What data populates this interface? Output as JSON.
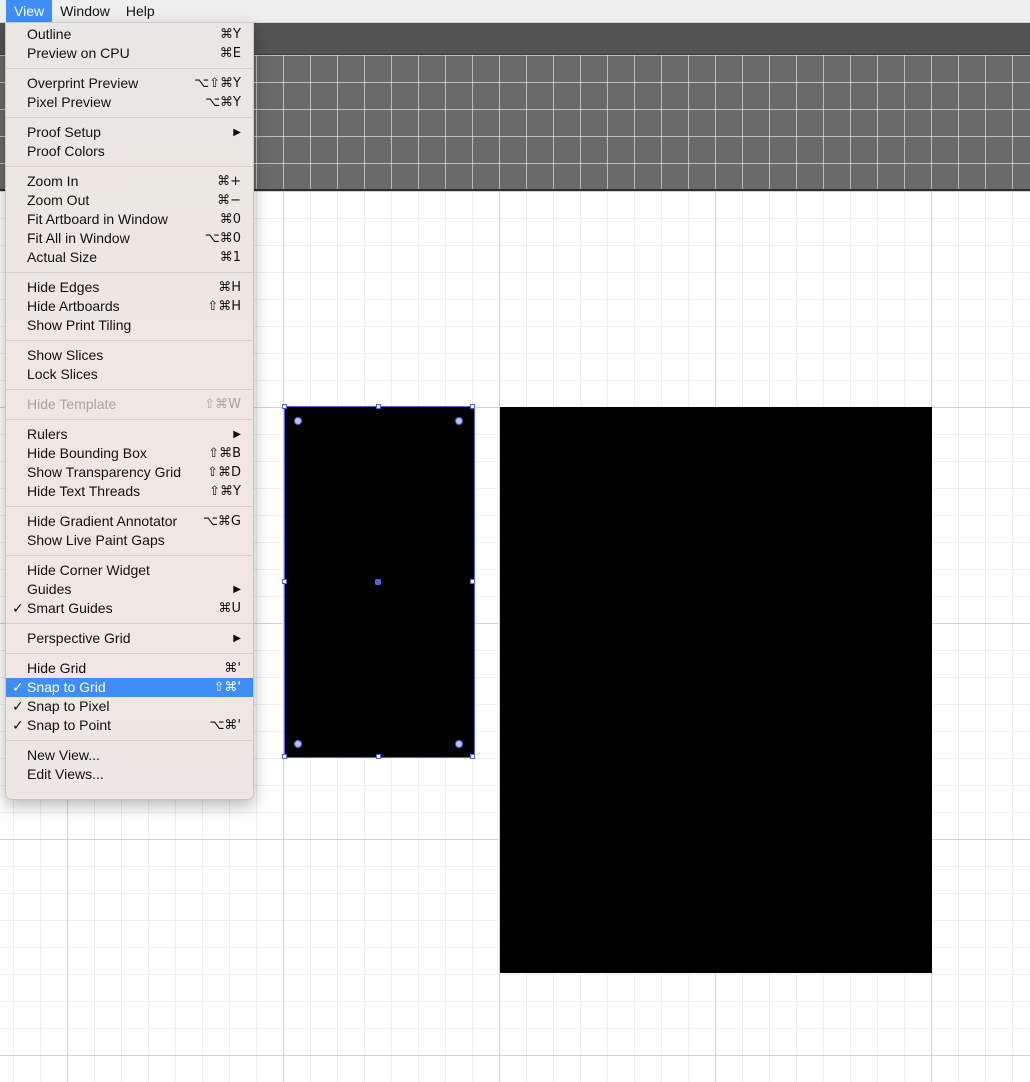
{
  "menubar": {
    "items": [
      "View",
      "Window",
      "Help"
    ]
  },
  "view_menu": {
    "groups": [
      [
        {
          "label": "Outline",
          "shortcut": "⌘Y"
        },
        {
          "label": "Preview on CPU",
          "shortcut": "⌘E"
        }
      ],
      [
        {
          "label": "Overprint Preview",
          "shortcut": "⌥⇧⌘Y"
        },
        {
          "label": "Pixel Preview",
          "shortcut": "⌥⌘Y"
        }
      ],
      [
        {
          "label": "Proof Setup",
          "submenu": true
        },
        {
          "label": "Proof Colors"
        }
      ],
      [
        {
          "label": "Zoom In",
          "shortcut": "⌘+"
        },
        {
          "label": "Zoom Out",
          "shortcut": "⌘−"
        },
        {
          "label": "Fit Artboard in Window",
          "shortcut": "⌘0"
        },
        {
          "label": "Fit All in Window",
          "shortcut": "⌥⌘0"
        },
        {
          "label": "Actual Size",
          "shortcut": "⌘1"
        }
      ],
      [
        {
          "label": "Hide Edges",
          "shortcut": "⌘H"
        },
        {
          "label": "Hide Artboards",
          "shortcut": "⇧⌘H"
        },
        {
          "label": "Show Print Tiling"
        }
      ],
      [
        {
          "label": "Show Slices"
        },
        {
          "label": "Lock Slices"
        }
      ],
      [
        {
          "label": "Hide Template",
          "shortcut": "⇧⌘W",
          "disabled": true
        }
      ],
      [
        {
          "label": "Rulers",
          "submenu": true
        },
        {
          "label": "Hide Bounding Box",
          "shortcut": "⇧⌘B"
        },
        {
          "label": "Show Transparency Grid",
          "shortcut": "⇧⌘D"
        },
        {
          "label": "Hide Text Threads",
          "shortcut": "⇧⌘Y"
        }
      ],
      [
        {
          "label": "Hide Gradient Annotator",
          "shortcut": "⌥⌘G"
        },
        {
          "label": "Show Live Paint Gaps"
        }
      ],
      [
        {
          "label": "Hide Corner Widget"
        },
        {
          "label": "Guides",
          "submenu": true
        },
        {
          "label": "Smart Guides",
          "shortcut": "⌘U",
          "checked": true
        }
      ],
      [
        {
          "label": "Perspective Grid",
          "submenu": true
        }
      ],
      [
        {
          "label": "Hide Grid",
          "shortcut": "⌘'"
        },
        {
          "label": "Snap to Grid",
          "shortcut": "⇧⌘'",
          "checked": true,
          "highlighted": true
        },
        {
          "label": "Snap to Pixel",
          "checked": true
        },
        {
          "label": "Snap to Point",
          "shortcut": "⌥⌘'",
          "checked": true
        }
      ],
      [
        {
          "label": "New View..."
        },
        {
          "label": "Edit Views..."
        }
      ]
    ]
  },
  "icons": {
    "checkmark": "✓",
    "submenu_arrow": "▶"
  },
  "colors": {
    "highlight": "#3f8ef7",
    "selection": "#4a66d8",
    "shape_fill": "#000000"
  }
}
